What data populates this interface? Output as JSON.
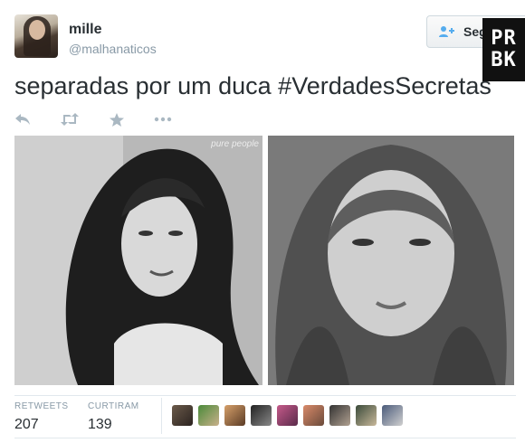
{
  "tweet": {
    "user_name": "mille",
    "user_handle": "@malhanaticos",
    "text": "separadas por um duca #VerdadesSecretas",
    "follow_label": "Seg",
    "image_watermark": "pure people"
  },
  "badge": {
    "line1": "PR",
    "line2": "BK"
  },
  "actions": [
    {
      "name": "reply-icon"
    },
    {
      "name": "retweet-icon"
    },
    {
      "name": "favorite-icon"
    },
    {
      "name": "more-icon"
    }
  ],
  "stats": {
    "retweets_label": "RETWEETS",
    "retweets_value": "207",
    "favorites_label": "CURTIRAM",
    "favorites_value": "139"
  },
  "colors": {
    "accent": "#55acee",
    "text": "#292f33",
    "muted": "#8899a6",
    "border": "#e1e8ed"
  },
  "favoriter_count": 9
}
